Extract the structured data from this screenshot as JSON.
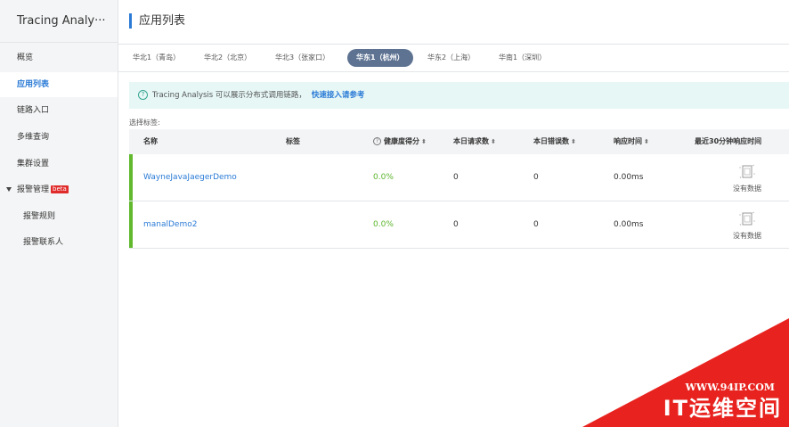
{
  "sidebar": {
    "title": "Tracing Analy···",
    "items": [
      {
        "label": "概览"
      },
      {
        "label": "应用列表"
      },
      {
        "label": "链路入口"
      },
      {
        "label": "多维查询"
      },
      {
        "label": "集群设置"
      },
      {
        "label": "报警管理",
        "badge": "beta"
      },
      {
        "label": "报警规则"
      },
      {
        "label": "报警联系人"
      }
    ]
  },
  "header": {
    "title": "应用列表"
  },
  "tabs": [
    {
      "label": "华北1（青岛）"
    },
    {
      "label": "华北2（北京）"
    },
    {
      "label": "华北3（张家口）"
    },
    {
      "label": "华东1（杭州）"
    },
    {
      "label": "华东2（上海）"
    },
    {
      "label": "华南1（深圳）"
    }
  ],
  "notice": {
    "icon": "?",
    "text": "Tracing Analysis 可以展示分布式调用链路，",
    "link": "快速接入请参考"
  },
  "tag_select_label": "选择标签:",
  "table": {
    "columns": {
      "name": "名称",
      "tag": "标签",
      "health": "健康度得分",
      "requests": "本日请求数",
      "errors": "本日错误数",
      "latency": "响应时间",
      "recent": "最近30分钟响应时间"
    },
    "sort_glyph": "⬍",
    "rows": [
      {
        "name": "WayneJavaJaegerDemo",
        "tag": "",
        "health": "0.0%",
        "requests": "0",
        "errors": "0",
        "latency": "0.00ms",
        "recent": "没有数据"
      },
      {
        "name": "manalDemo2",
        "tag": "",
        "health": "0.0%",
        "requests": "0",
        "errors": "0",
        "latency": "0.00ms",
        "recent": "没有数据"
      }
    ]
  },
  "watermark": {
    "url": "WWW.94IP.COM",
    "text": "IT运维空间"
  },
  "colors": {
    "accent": "#2b7bd6",
    "active_tab": "#5e7392",
    "health": "#62b92e",
    "watermark": "#e8231f"
  }
}
